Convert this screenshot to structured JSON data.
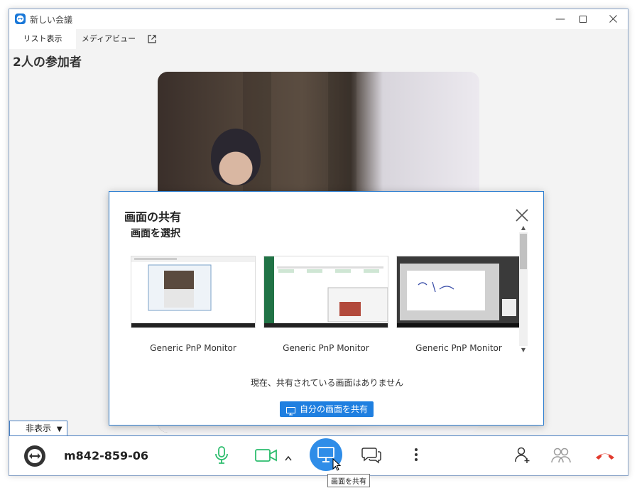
{
  "window": {
    "title": "新しい会議"
  },
  "tabs": {
    "list": "リスト表示",
    "media": "メディアビュー"
  },
  "participants": {
    "heading": "2人の参加者"
  },
  "share_dialog": {
    "title": "画面の共有",
    "subtitle": "画面を選択",
    "screens": [
      {
        "label": "Generic PnP Monitor"
      },
      {
        "label": "Generic PnP Monitor"
      },
      {
        "label": "Generic PnP Monitor"
      }
    ],
    "status": "現在、共有されている画面はありません",
    "share_button": "自分の画面を共有"
  },
  "toolbar": {
    "hide_label": "非表示",
    "meeting_id": "m842-859-06",
    "share_tooltip": "画面を共有"
  },
  "colors": {
    "accent": "#1f7fe0",
    "mic_green": "#2dbd6e",
    "end_red": "#e23b2e",
    "border_blue": "#4a7fc0"
  }
}
